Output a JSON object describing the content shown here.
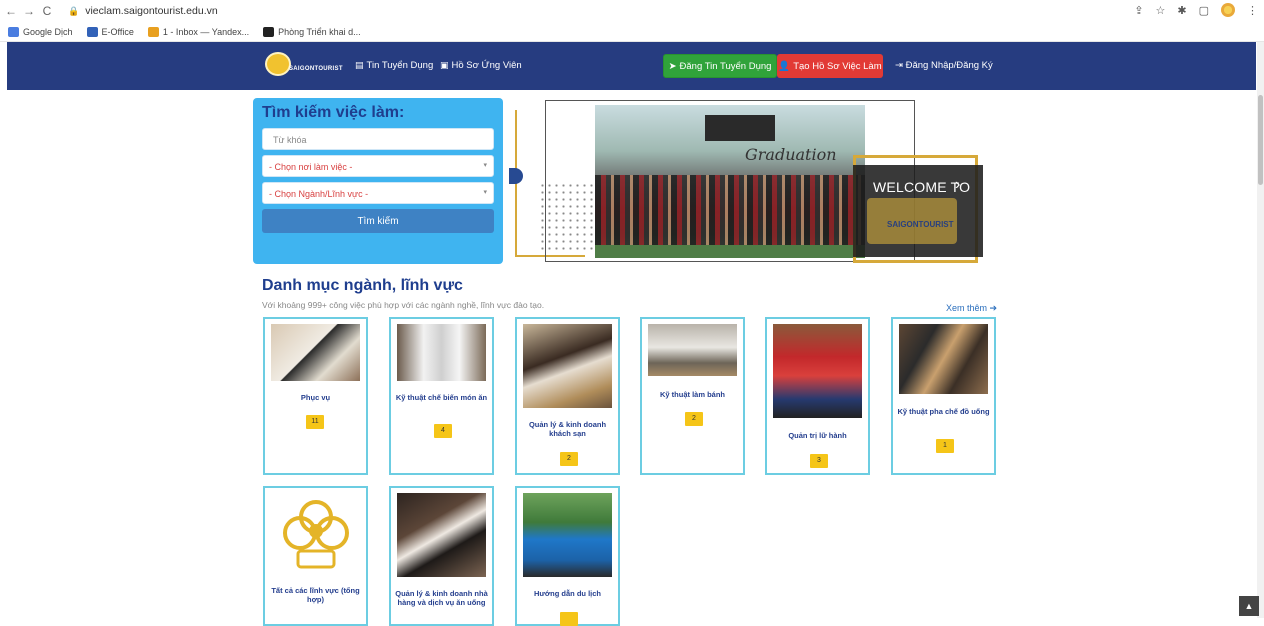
{
  "browser": {
    "url": "vieclam.saigontourist.edu.vn",
    "bookmarks": [
      "Google Dịch",
      "E-Office",
      "1 - Inbox — Yandex...",
      "Phòng Triển khai d..."
    ]
  },
  "navbar": {
    "logo_text": "SAIGONTOURIST",
    "links": [
      "Tin Tuyển Dụng",
      "Hồ Sơ Ứng Viên"
    ],
    "post_job_button": "Đăng Tin Tuyển Dụng",
    "create_cv_button": "Tạo Hồ Sơ Việc Làm",
    "login": "Đăng Nhập/Đăng Ký"
  },
  "search": {
    "title": "Tìm kiếm việc làm:",
    "keyword_placeholder": "Từ khóa",
    "location_value": "- Chọn nơi làm việc -",
    "industry_value": "- Chọn Ngành/Lĩnh vực -",
    "button": "Tìm kiếm"
  },
  "banner": {
    "graduation_text": "Graduation",
    "welcome": "WELCOME TO",
    "logo_text": "SAIGONTOURIST"
  },
  "categories": {
    "title": "Danh mục ngành, lĩnh vực",
    "subtitle": "Với khoảng 999+ công việc phù hợp với các ngành nghề, lĩnh vực đào tạo.",
    "see_more": "Xem thêm",
    "items": [
      {
        "label": "Phục vụ",
        "count": "11"
      },
      {
        "label": "Kỹ thuật chế biến món ăn",
        "count": "4"
      },
      {
        "label": "Quản lý & kinh doanh khách sạn",
        "count": "2"
      },
      {
        "label": "Kỹ thuật làm bánh",
        "count": "2"
      },
      {
        "label": "Quản trị lữ hành",
        "count": "3"
      },
      {
        "label": "Kỹ thuật pha chế đồ uống",
        "count": "1"
      },
      {
        "label": "Tất cả các lĩnh vực (tổng hợp)",
        "count": ""
      },
      {
        "label": "Quản lý & kinh doanh nhà hàng và dịch vụ ăn uống",
        "count": ""
      },
      {
        "label": "Hướng dẫn du lịch",
        "count": ""
      }
    ]
  },
  "colors": {
    "navbar": "#263c80",
    "search_panel": "#3fb4f0",
    "accent_blue": "#1f3e8e",
    "green": "#30a33a",
    "red": "#e23a35",
    "badge": "#f5c518",
    "card_border": "#6ccde2"
  }
}
